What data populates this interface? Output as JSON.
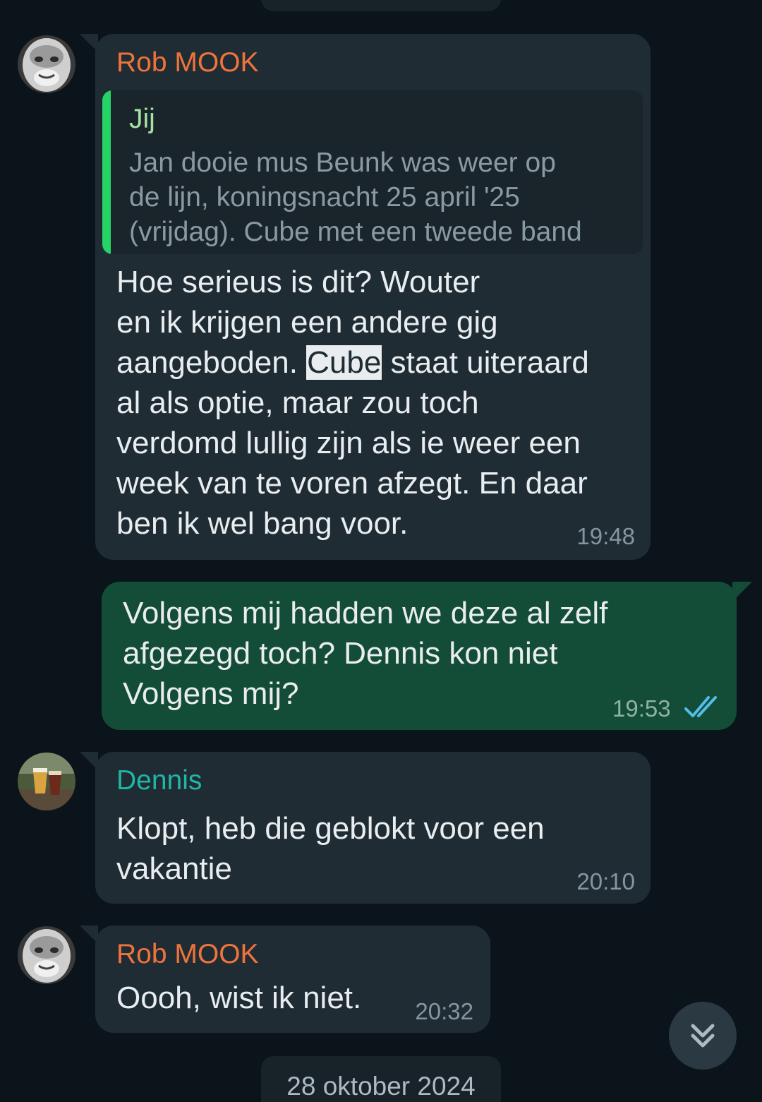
{
  "chat": {
    "top_date_chip": "",
    "bottom_date_chip": "28 oktober 2024",
    "messages": [
      {
        "sender": "Rob MOOK",
        "sender_color": "#f0733c",
        "quote": {
          "author": "Jij",
          "text": "Jan dooie mus Beunk was weer op\nde lijn,  koningsnacht 25 april '25\n(vrijdag). Cube met een tweede band"
        },
        "text_before_highlight": "Hoe serieus is dit? Wouter\nen ik krijgen een andere gig\naangeboden. ",
        "highlight": "Cube",
        "text_after_highlight": " staat uiteraard\nal als optie, maar zou toch\nverdomd lullig zijn als ie weer een\nweek van te voren afzegt. En daar\nben ik wel bang voor.",
        "time": "19:48"
      },
      {
        "outgoing": true,
        "text": "Volgens mij hadden we deze al zelf\nafgezegd toch? Dennis kon niet\nVolgens mij?",
        "time": "19:53",
        "status_icon": "double-check-read-icon",
        "status_color": "#53bdeb"
      },
      {
        "sender": "Dennis",
        "sender_color": "#21b5a6",
        "text": "Klopt, heb die geblokt voor een\nvakantie",
        "time": "20:10"
      },
      {
        "sender": "Rob MOOK",
        "sender_color": "#f0733c",
        "text": "Oooh, wist ik niet.",
        "time": "20:32"
      }
    ],
    "scroll_button_icon": "double-chevron-down-icon"
  }
}
